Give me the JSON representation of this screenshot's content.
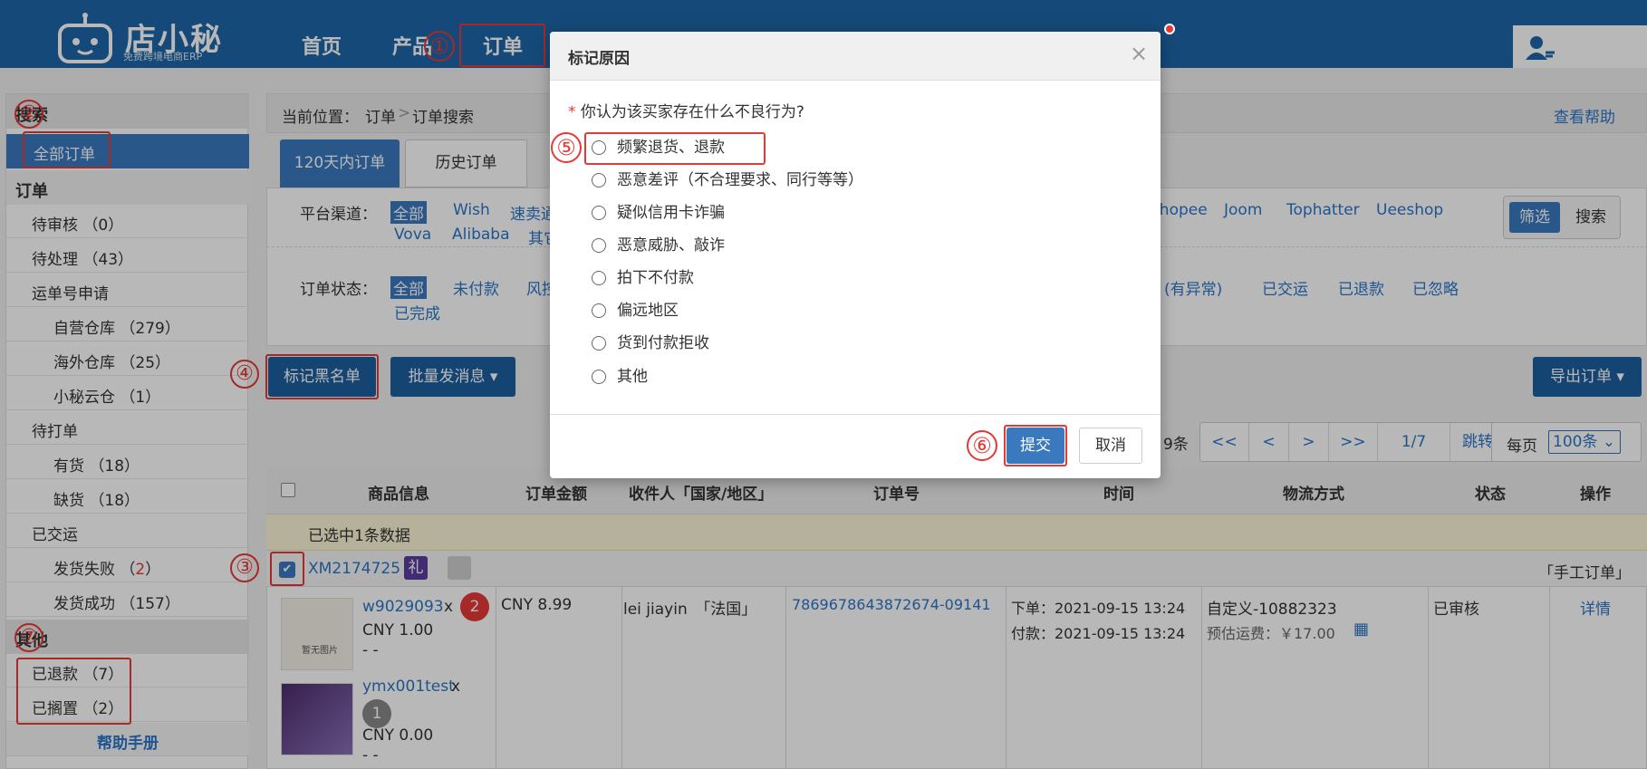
{
  "app": {
    "logo_text": "店小秘",
    "logo_sub": "免费跨境电商ERP"
  },
  "nav": {
    "home": "首页",
    "products": "产品",
    "orders": "订单"
  },
  "annotations": {
    "n1": "①",
    "n2": "②",
    "n3": "③",
    "n4": "④",
    "n5": "⑤",
    "n6": "⑥",
    "n7": "⑦"
  },
  "sidebar": {
    "search_head": "搜索",
    "all_orders": "全部订单",
    "orders_head": "订单",
    "items": [
      {
        "label": "待审核",
        "count": "（0）"
      },
      {
        "label": "待处理",
        "count": "（43）"
      },
      {
        "label": "运单号申请",
        "count": ""
      },
      {
        "label": "自营仓库",
        "count": "（279）"
      },
      {
        "label": "海外仓库",
        "count": "（25）"
      },
      {
        "label": "小秘云仓",
        "count": "（1）"
      },
      {
        "label": "待打单",
        "count": ""
      },
      {
        "label": "有货",
        "count": "（18）"
      },
      {
        "label": "缺货",
        "count": "（18）"
      },
      {
        "label": "已交运",
        "count": ""
      },
      {
        "label": "发货失败",
        "count_pre": "（",
        "count_red": "2",
        "count_post": "）"
      },
      {
        "label": "发货成功",
        "count": "（157）"
      }
    ],
    "other_head": "其他",
    "refunded": "已退款 （7）",
    "shelved": "已搁置 （2）",
    "help": "帮助手册"
  },
  "breadcrumb": {
    "prefix": "当前位置：",
    "section": "订单",
    "sep": ">",
    "page": "订单搜索",
    "help": "查看帮助"
  },
  "tabs": {
    "recent": "120天内订单",
    "history": "历史订单"
  },
  "filters": {
    "platform_label": "平台渠道：",
    "platform_all": "全部",
    "platforms_row1": [
      "Wish",
      "速卖通"
    ],
    "platforms_row1_right": [
      "Shopee",
      "Joom",
      "Tophatter",
      "Ueeshop"
    ],
    "platforms_row2": [
      "Vova",
      "Alibaba",
      "其它"
    ],
    "filter_btn": "筛选",
    "search_btn": "搜索",
    "status_label": "订单状态：",
    "status_all": "全部",
    "statuses_left": [
      "未付款",
      "风控"
    ],
    "statuses_right": [
      "(有异常)",
      "已交运",
      "已退款",
      "已忽略"
    ],
    "status_row2": "已完成"
  },
  "actions": {
    "blacklist": "标记黑名单",
    "batch_msg": "批量发消息 ▾",
    "export": "导出订单 ▾"
  },
  "pager": {
    "total": "9条",
    "first": "<<",
    "prev": "<",
    "next": ">",
    "last": ">>",
    "page": "1/7",
    "jump": "跳转",
    "per_page_label": "每页",
    "per_page": "100条"
  },
  "table": {
    "headers": [
      "商品信息",
      "订单金额",
      "收件人「国家/地区」",
      "订单号",
      "时间",
      "物流方式",
      "状态",
      "操作"
    ],
    "selected_info": "已选中1条数据",
    "order_id": "XM2174725",
    "gift": "礼",
    "manual": "「手工订单」",
    "item1": {
      "sku": "w9029093",
      "x": "x",
      "qty": "2",
      "price": "CNY 1.00",
      "dash": "- -",
      "noimg": "暂无图片"
    },
    "item2": {
      "sku": "ymx001test",
      "x": "x",
      "qty": "1",
      "price": "CNY 0.00",
      "dash": "- -"
    },
    "amount": "CNY 8.99",
    "recipient": "lei jiayin　「法国」",
    "order_no": "7869678643872674-09141",
    "time_order": "下单：2021-09-15 13:24",
    "time_pay": "付款：2021-09-15 13:24",
    "logistics": "自定义-10882323",
    "freight": "预估运费：￥17.00",
    "status": "已审核",
    "op": "详情"
  },
  "modal": {
    "title": "标记原因",
    "question_star": "*",
    "question": "你认为该买家存在什么不良行为?",
    "options": [
      "频繁退货、退款",
      "恶意差评（不合理要求、同行等等）",
      "疑似信用卡诈骗",
      "恶意威胁、敲诈",
      "拍下不付款",
      "偏远地区",
      "货到付款拒收",
      "其他"
    ],
    "submit": "提交",
    "cancel": "取消",
    "close": "×"
  },
  "colors": {
    "brand": "#1e66a8",
    "primary": "#1d5f9e",
    "link": "#2a75c8",
    "highlight": "#e53935"
  }
}
